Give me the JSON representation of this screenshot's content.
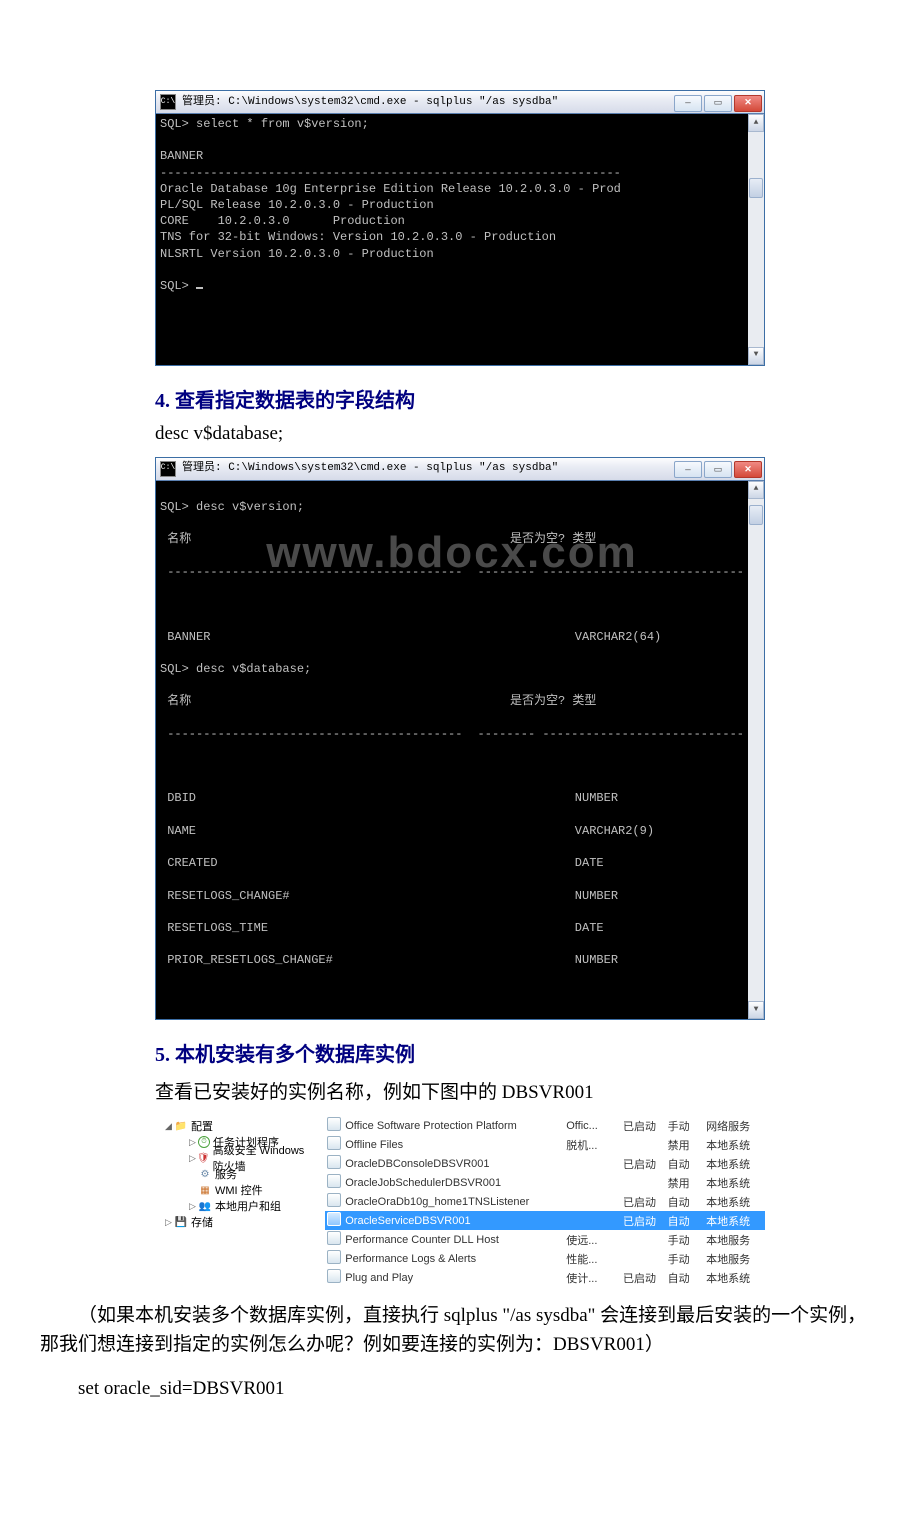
{
  "cmd1": {
    "title": "管理员: C:\\Windows\\system32\\cmd.exe - sqlplus  \"/as sysdba\"",
    "body": "SQL> select * from v$version;\n\nBANNER\n----------------------------------------------------------------\nOracle Database 10g Enterprise Edition Release 10.2.0.3.0 - Prod\nPL/SQL Release 10.2.0.3.0 - Production\nCORE    10.2.0.3.0      Production\nTNS for 32-bit Windows: Version 10.2.0.3.0 - Production\nNLSRTL Version 10.2.0.3.0 - Production\n\nSQL> "
  },
  "sect4": {
    "title": "4. 查看指定数据表的字段结构",
    "code": "desc v$database;"
  },
  "cmd2": {
    "title": "管理员: C:\\Windows\\system32\\cmd.exe - sqlplus  \"/as sysdba\"",
    "line1l": "SQL> desc v$version;",
    "line1r": "",
    "line2l": " 名称",
    "line2r": "是否为空? 类型",
    "hr": " -----------------------------------------",
    "hrR": "-------- ----------------------------",
    "bannerL": " BANNER",
    "bannerR": "         VARCHAR2(64)",
    "line3l": "SQL> desc v$database;",
    "line4l": " 名称",
    "line4r": "是否为空? 类型",
    "rows": [
      {
        "l": " DBID",
        "r": "         NUMBER"
      },
      {
        "l": " NAME",
        "r": "         VARCHAR2(9)"
      },
      {
        "l": " CREATED",
        "r": "         DATE"
      },
      {
        "l": " RESETLOGS_CHANGE#",
        "r": "         NUMBER"
      },
      {
        "l": " RESETLOGS_TIME",
        "r": "         DATE"
      },
      {
        "l": " PRIOR_RESETLOGS_CHANGE#",
        "r": "         NUMBER"
      }
    ],
    "watermark": "www.bdocx.com"
  },
  "sect5": {
    "title": "5. 本机安装有多个数据库实例",
    "sub": "查看已安装好的实例名称，例如下图中的 DBSVR001"
  },
  "tree": {
    "root": "配置",
    "items": [
      "任务计划程序",
      "高级安全 Windows 防火墙",
      "服务",
      "WMI 控件",
      "本地用户和组"
    ],
    "storage": "存储"
  },
  "services": [
    {
      "name": "Office Software Protection Platform",
      "desc": "Offic...",
      "status": "已启动",
      "mode": "手动",
      "acct": "网络服务"
    },
    {
      "name": "Offline Files",
      "desc": "脱机...",
      "status": "",
      "mode": "禁用",
      "acct": "本地系统"
    },
    {
      "name": "OracleDBConsoleDBSVR001",
      "desc": "",
      "status": "已启动",
      "mode": "自动",
      "acct": "本地系统"
    },
    {
      "name": "OracleJobSchedulerDBSVR001",
      "desc": "",
      "status": "",
      "mode": "禁用",
      "acct": "本地系统"
    },
    {
      "name": "OracleOraDb10g_home1TNSListener",
      "desc": "",
      "status": "已启动",
      "mode": "自动",
      "acct": "本地系统"
    },
    {
      "name": "OracleServiceDBSVR001",
      "desc": "",
      "status": "已启动",
      "mode": "自动",
      "acct": "本地系统",
      "selected": true
    },
    {
      "name": "Performance Counter DLL Host",
      "desc": "使远...",
      "status": "",
      "mode": "手动",
      "acct": "本地服务"
    },
    {
      "name": "Performance Logs & Alerts",
      "desc": "性能...",
      "status": "",
      "mode": "手动",
      "acct": "本地服务"
    },
    {
      "name": "Plug and Play",
      "desc": "使计...",
      "status": "已启动",
      "mode": "自动",
      "acct": "本地系统"
    }
  ],
  "para": "（如果本机安装多个数据库实例，直接执行 sqlplus \"/as sysdba\" 会连接到最后安装的一个实例，那我们想连接到指定的实例怎么办呢？例如要连接的实例为：DBSVR001）",
  "setLine": "set oracle_sid=DBSVR001"
}
